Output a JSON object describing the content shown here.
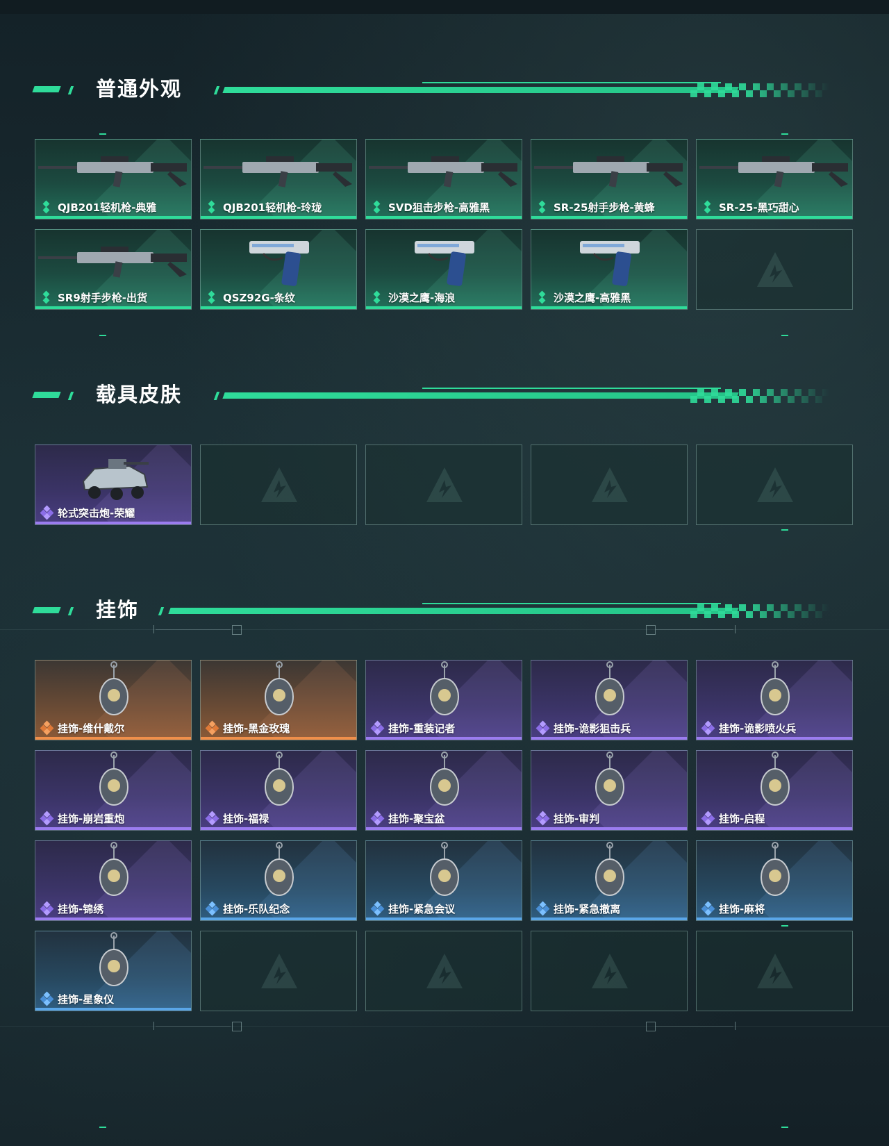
{
  "colors": {
    "accent": "#2fdc9a",
    "purple": "#9b7cf0",
    "orange": "#f08f4a",
    "blue": "#5aa6e8"
  },
  "sections": [
    {
      "title": "普通外观",
      "items": [
        {
          "label": "QJB201轻机枪-典雅",
          "rarity": "green",
          "icon": "light-machine-gun-icon"
        },
        {
          "label": "QJB201轻机枪-玲珑",
          "rarity": "green",
          "icon": "light-machine-gun-icon"
        },
        {
          "label": "SVD狙击步枪-高雅黑",
          "rarity": "green",
          "icon": "sniper-rifle-icon"
        },
        {
          "label": "SR-25射手步枪-黄蜂",
          "rarity": "green",
          "icon": "marksman-rifle-icon"
        },
        {
          "label": "SR-25-黑巧甜心",
          "rarity": "green",
          "icon": "marksman-rifle-icon"
        },
        {
          "label": "SR9射手步枪-出货",
          "rarity": "green",
          "icon": "marksman-rifle-icon"
        },
        {
          "label": "QSZ92G-条纹",
          "rarity": "green",
          "icon": "pistol-icon"
        },
        {
          "label": "沙漠之鹰-海浪",
          "rarity": "green",
          "icon": "pistol-icon"
        },
        {
          "label": "沙漠之鹰-高雅黑",
          "rarity": "green",
          "icon": "pistol-icon"
        },
        {
          "label": "",
          "rarity": "empty",
          "icon": "logo-watermark-icon"
        }
      ]
    },
    {
      "title": "载具皮肤",
      "items": [
        {
          "label": "轮式突击炮-荣耀",
          "rarity": "purple",
          "icon": "vehicle-icon"
        },
        {
          "label": "",
          "rarity": "empty",
          "icon": "logo-watermark-icon"
        },
        {
          "label": "",
          "rarity": "empty",
          "icon": "logo-watermark-icon"
        },
        {
          "label": "",
          "rarity": "empty",
          "icon": "logo-watermark-icon"
        },
        {
          "label": "",
          "rarity": "empty",
          "icon": "logo-watermark-icon"
        }
      ]
    },
    {
      "title": "挂饰",
      "items": [
        {
          "label": "挂饰-维什戴尔",
          "rarity": "orange",
          "icon": "charm-icon"
        },
        {
          "label": "挂饰-黑金玫瑰",
          "rarity": "orange",
          "icon": "charm-icon"
        },
        {
          "label": "挂饰-重装记者",
          "rarity": "purple",
          "icon": "charm-icon"
        },
        {
          "label": "挂饰-诡影狙击兵",
          "rarity": "purple",
          "icon": "charm-icon"
        },
        {
          "label": "挂饰-诡影喷火兵",
          "rarity": "purple",
          "icon": "charm-icon"
        },
        {
          "label": "挂饰-崩岩重炮",
          "rarity": "purple",
          "icon": "charm-icon"
        },
        {
          "label": "挂饰-福禄",
          "rarity": "purple",
          "icon": "charm-icon"
        },
        {
          "label": "挂饰-聚宝盆",
          "rarity": "purple",
          "icon": "charm-icon"
        },
        {
          "label": "挂饰-审判",
          "rarity": "purple",
          "icon": "charm-icon"
        },
        {
          "label": "挂饰-启程",
          "rarity": "purple",
          "icon": "charm-icon"
        },
        {
          "label": "挂饰-锦绣",
          "rarity": "purple",
          "icon": "charm-icon"
        },
        {
          "label": "挂饰-乐队纪念",
          "rarity": "blue",
          "icon": "charm-icon"
        },
        {
          "label": "挂饰-紧急会议",
          "rarity": "blue",
          "icon": "charm-icon"
        },
        {
          "label": "挂饰-紧急撤离",
          "rarity": "blue",
          "icon": "charm-icon"
        },
        {
          "label": "挂饰-麻将",
          "rarity": "blue",
          "icon": "charm-icon"
        },
        {
          "label": "挂饰-星象仪",
          "rarity": "blue",
          "icon": "charm-icon"
        },
        {
          "label": "",
          "rarity": "empty",
          "icon": "logo-watermark-icon"
        },
        {
          "label": "",
          "rarity": "empty",
          "icon": "logo-watermark-icon"
        },
        {
          "label": "",
          "rarity": "empty",
          "icon": "logo-watermark-icon"
        },
        {
          "label": "",
          "rarity": "empty",
          "icon": "logo-watermark-icon"
        }
      ]
    }
  ]
}
